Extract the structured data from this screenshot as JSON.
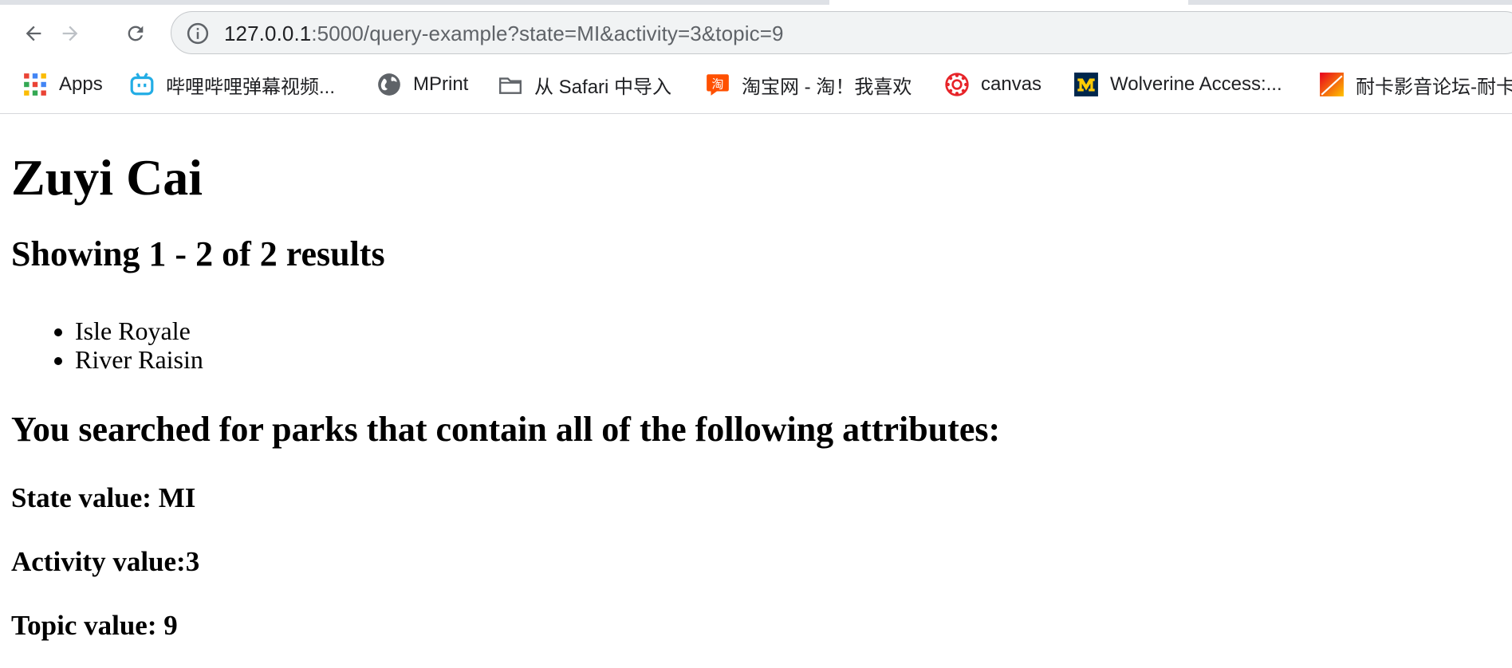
{
  "browser": {
    "url_host": "127.0.0.1",
    "url_rest": ":5000/query-example?state=MI&activity=3&topic=9",
    "bookmarks": [
      {
        "label": "Apps",
        "icon": "apps-grid-icon"
      },
      {
        "label": "哔哩哔哩弹幕视频...",
        "icon": "bilibili-icon"
      },
      {
        "label": "MPrint",
        "icon": "globe-icon"
      },
      {
        "label": "从 Safari 中导入",
        "icon": "folder-icon"
      },
      {
        "label": "淘宝网 - 淘！我喜欢",
        "icon": "taobao-icon"
      },
      {
        "label": "canvas",
        "icon": "canvas-icon"
      },
      {
        "label": "Wolverine Access:...",
        "icon": "michigan-m-icon"
      },
      {
        "label": "耐卡影音论坛-耐卡",
        "icon": "naika-icon"
      }
    ]
  },
  "page": {
    "title": "Zuyi Cai",
    "results_heading": "Showing 1 - 2 of 2 results",
    "parks": [
      "Isle Royale",
      "River Raisin"
    ],
    "searched_heading": "You searched for parks that contain all of the following attributes:",
    "state_line": "State value: MI",
    "activity_line": "Activity value:3",
    "topic_line": "Topic value: 9"
  },
  "colors": {
    "omnibox_bg": "#f1f3f4",
    "bilibili": "#23ade5",
    "taobao": "#ff5000",
    "canvas": "#e72429",
    "michigan_blue": "#00274c",
    "michigan_maize": "#ffcb05"
  }
}
